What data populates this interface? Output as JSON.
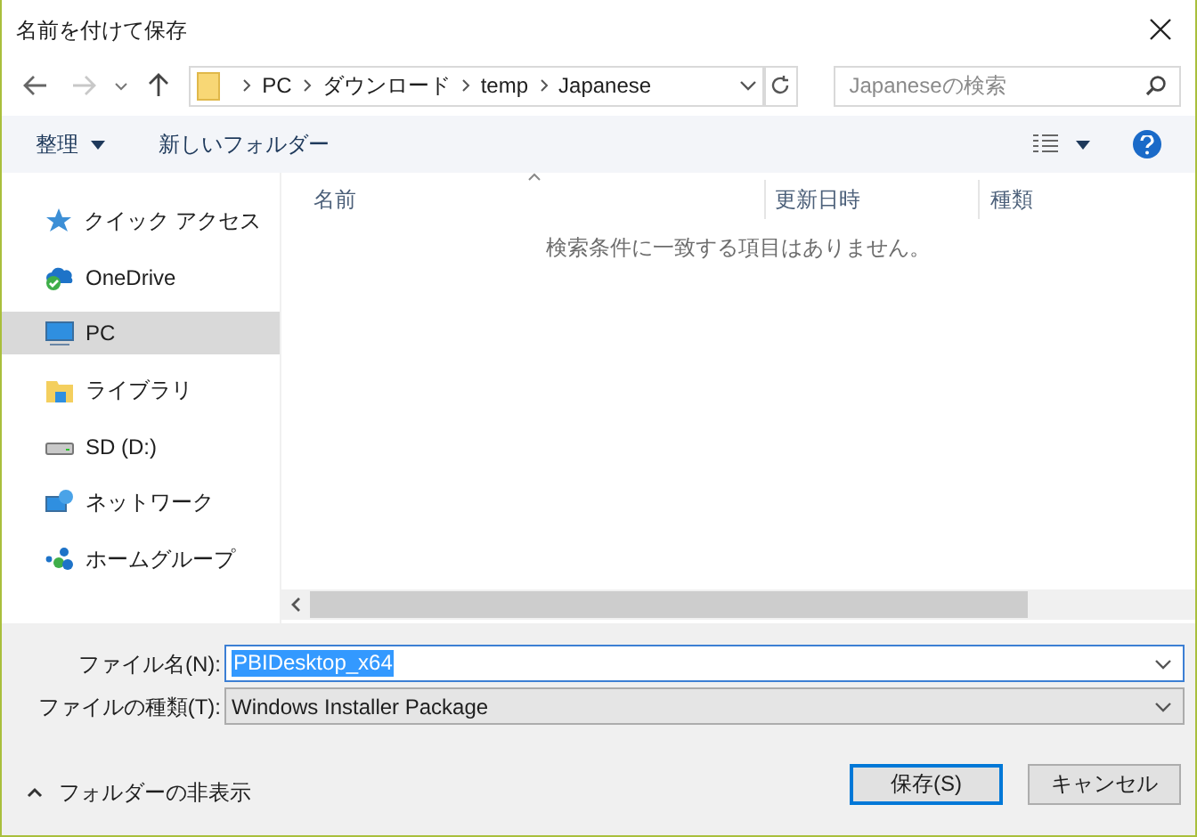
{
  "window": {
    "title": "名前を付けて保存"
  },
  "address": {
    "path": [
      "PC",
      "ダウンロード",
      "temp",
      "Japanese"
    ]
  },
  "search": {
    "placeholder": "Japaneseの検索"
  },
  "toolbar": {
    "organize": "整理",
    "new_folder": "新しいフォルダー"
  },
  "sidebar": {
    "items": [
      {
        "label": "クイック アクセス",
        "kind": "star",
        "selected": false
      },
      {
        "label": "OneDrive",
        "kind": "cloud",
        "selected": false
      },
      {
        "label": "PC",
        "kind": "monitor",
        "selected": true
      },
      {
        "label": "ライブラリ",
        "kind": "library",
        "selected": false
      },
      {
        "label": "SD (D:)",
        "kind": "drive",
        "selected": false
      },
      {
        "label": "ネットワーク",
        "kind": "network",
        "selected": false
      },
      {
        "label": "ホームグループ",
        "kind": "homegroup",
        "selected": false
      }
    ]
  },
  "file_list": {
    "columns": [
      "名前",
      "更新日時",
      "種類"
    ],
    "empty_message": "検索条件に一致する項目はありません。"
  },
  "file_name": {
    "label": "ファイル名(N):",
    "value": "PBIDesktop_x64"
  },
  "file_type": {
    "label": "ファイルの種類(T):",
    "value": "Windows Installer Package"
  },
  "hide_folders": "フォルダーの非表示",
  "buttons": [
    {
      "label": "保存(S)",
      "default": true
    },
    {
      "label": "キャンセル",
      "default": false
    }
  ]
}
